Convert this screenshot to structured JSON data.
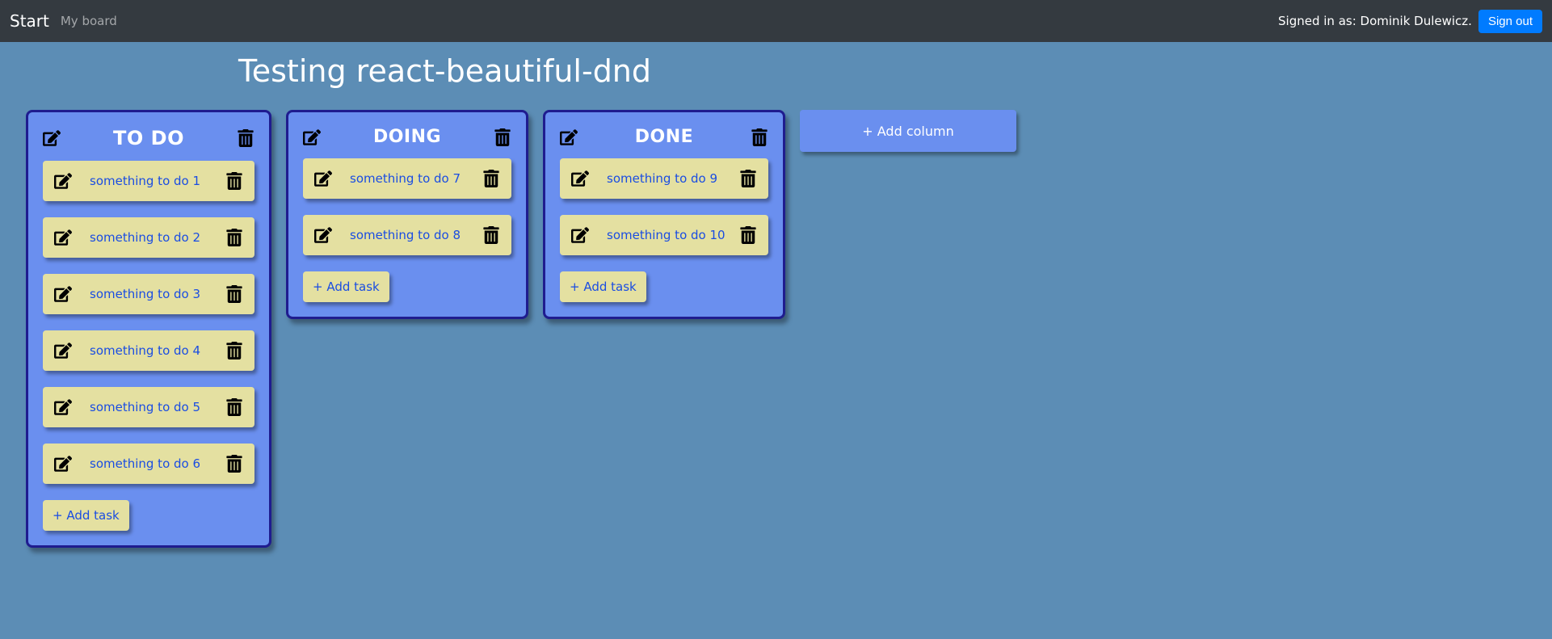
{
  "nav": {
    "brand": "Start",
    "board_link": "My board",
    "signed_in_prefix": "Signed in as: ",
    "user_name": "Dominik Dulewicz.",
    "sign_out": "Sign out"
  },
  "page": {
    "title": "Testing react-beautiful-dnd"
  },
  "board": {
    "add_column": "+ Add column",
    "add_task": "+ Add task",
    "columns": [
      {
        "title": "TO DO",
        "tasks": [
          "something to do 1",
          "something to do 2",
          "something to do 3",
          "something to do 4",
          "something to do 5",
          "something to do 6"
        ]
      },
      {
        "title": "DOING",
        "tasks": [
          "something to do 7",
          "something to do 8"
        ]
      },
      {
        "title": "DONE",
        "tasks": [
          "something to do 9",
          "something to do 10"
        ]
      }
    ]
  }
}
